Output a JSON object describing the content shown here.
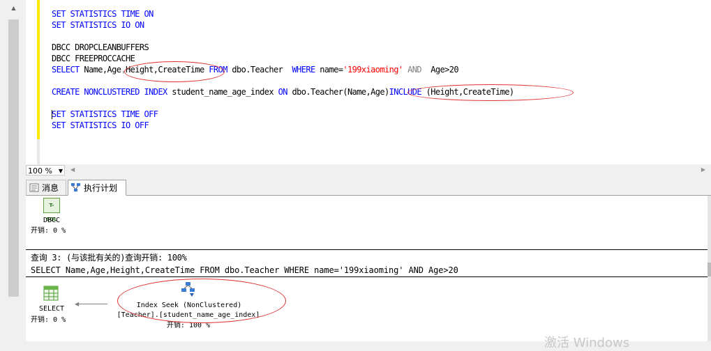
{
  "editor": {
    "lines": [
      {
        "kind": "kw",
        "text": "SET STATISTICS TIME ON"
      },
      {
        "kind": "kw",
        "text": "SET STATISTICS IO ON"
      },
      {
        "kind": "blank",
        "text": ""
      },
      {
        "kind": "plain",
        "text": "DBCC DROPCLEANBUFFERS"
      },
      {
        "kind": "plain",
        "text": "DBCC FREEPROCCACHE"
      },
      {
        "kind": "select",
        "text": ""
      },
      {
        "kind": "blank",
        "text": ""
      },
      {
        "kind": "create",
        "text": ""
      },
      {
        "kind": "blank",
        "text": ""
      },
      {
        "kind": "kw",
        "text": "SET STATISTICS TIME OFF"
      },
      {
        "kind": "kw",
        "text": "SET STATISTICS IO OFF"
      }
    ],
    "select_stmt": {
      "k_select": "SELECT",
      "cols1": " Name,Age",
      "comma1": ",",
      "cols2": "Height,CreateTime",
      "k_from": " FROM",
      "table": " dbo.Teacher  ",
      "k_where": "WHERE",
      "cond1": " name=",
      "str": "'199xiaoming'",
      "k_and": " AND",
      "cond2": "  Age>20"
    },
    "create_stmt": {
      "k_create": "CREATE NONCLUSTERED INDEX",
      "name": " student_name_age_index ",
      "k_on": "ON",
      "target": " dbo.Teacher(Name,Age)",
      "k_include": "INCLUDE",
      "include_cols": " (Height,CreateTime)"
    }
  },
  "zoom": {
    "value": "100 %"
  },
  "tabs": [
    {
      "label": "消息"
    },
    {
      "label": "执行计划"
    }
  ],
  "plan": {
    "dbcc_node": {
      "name": "DBCC",
      "cost": "开销: 0 %",
      "icon_text": "T-SQL"
    },
    "query_header": "查询 3: (与该批有关的)查询开销: 100%",
    "query_text": "SELECT Name,Age,Height,CreateTime FROM dbo.Teacher WHERE name='199xiaoming' AND Age>20",
    "select_node": {
      "name": "SELECT",
      "cost": "开销: 0 %"
    },
    "seek_node": {
      "name": "Index Seek (NonClustered)",
      "object": "[Teacher].[student_name_age_index]",
      "cost": "开销: 100 %"
    }
  },
  "watermark": "激活 Windows",
  "colors": {
    "keyword": "#0000ff",
    "string": "#ff0000",
    "annotation": "#e03030"
  }
}
